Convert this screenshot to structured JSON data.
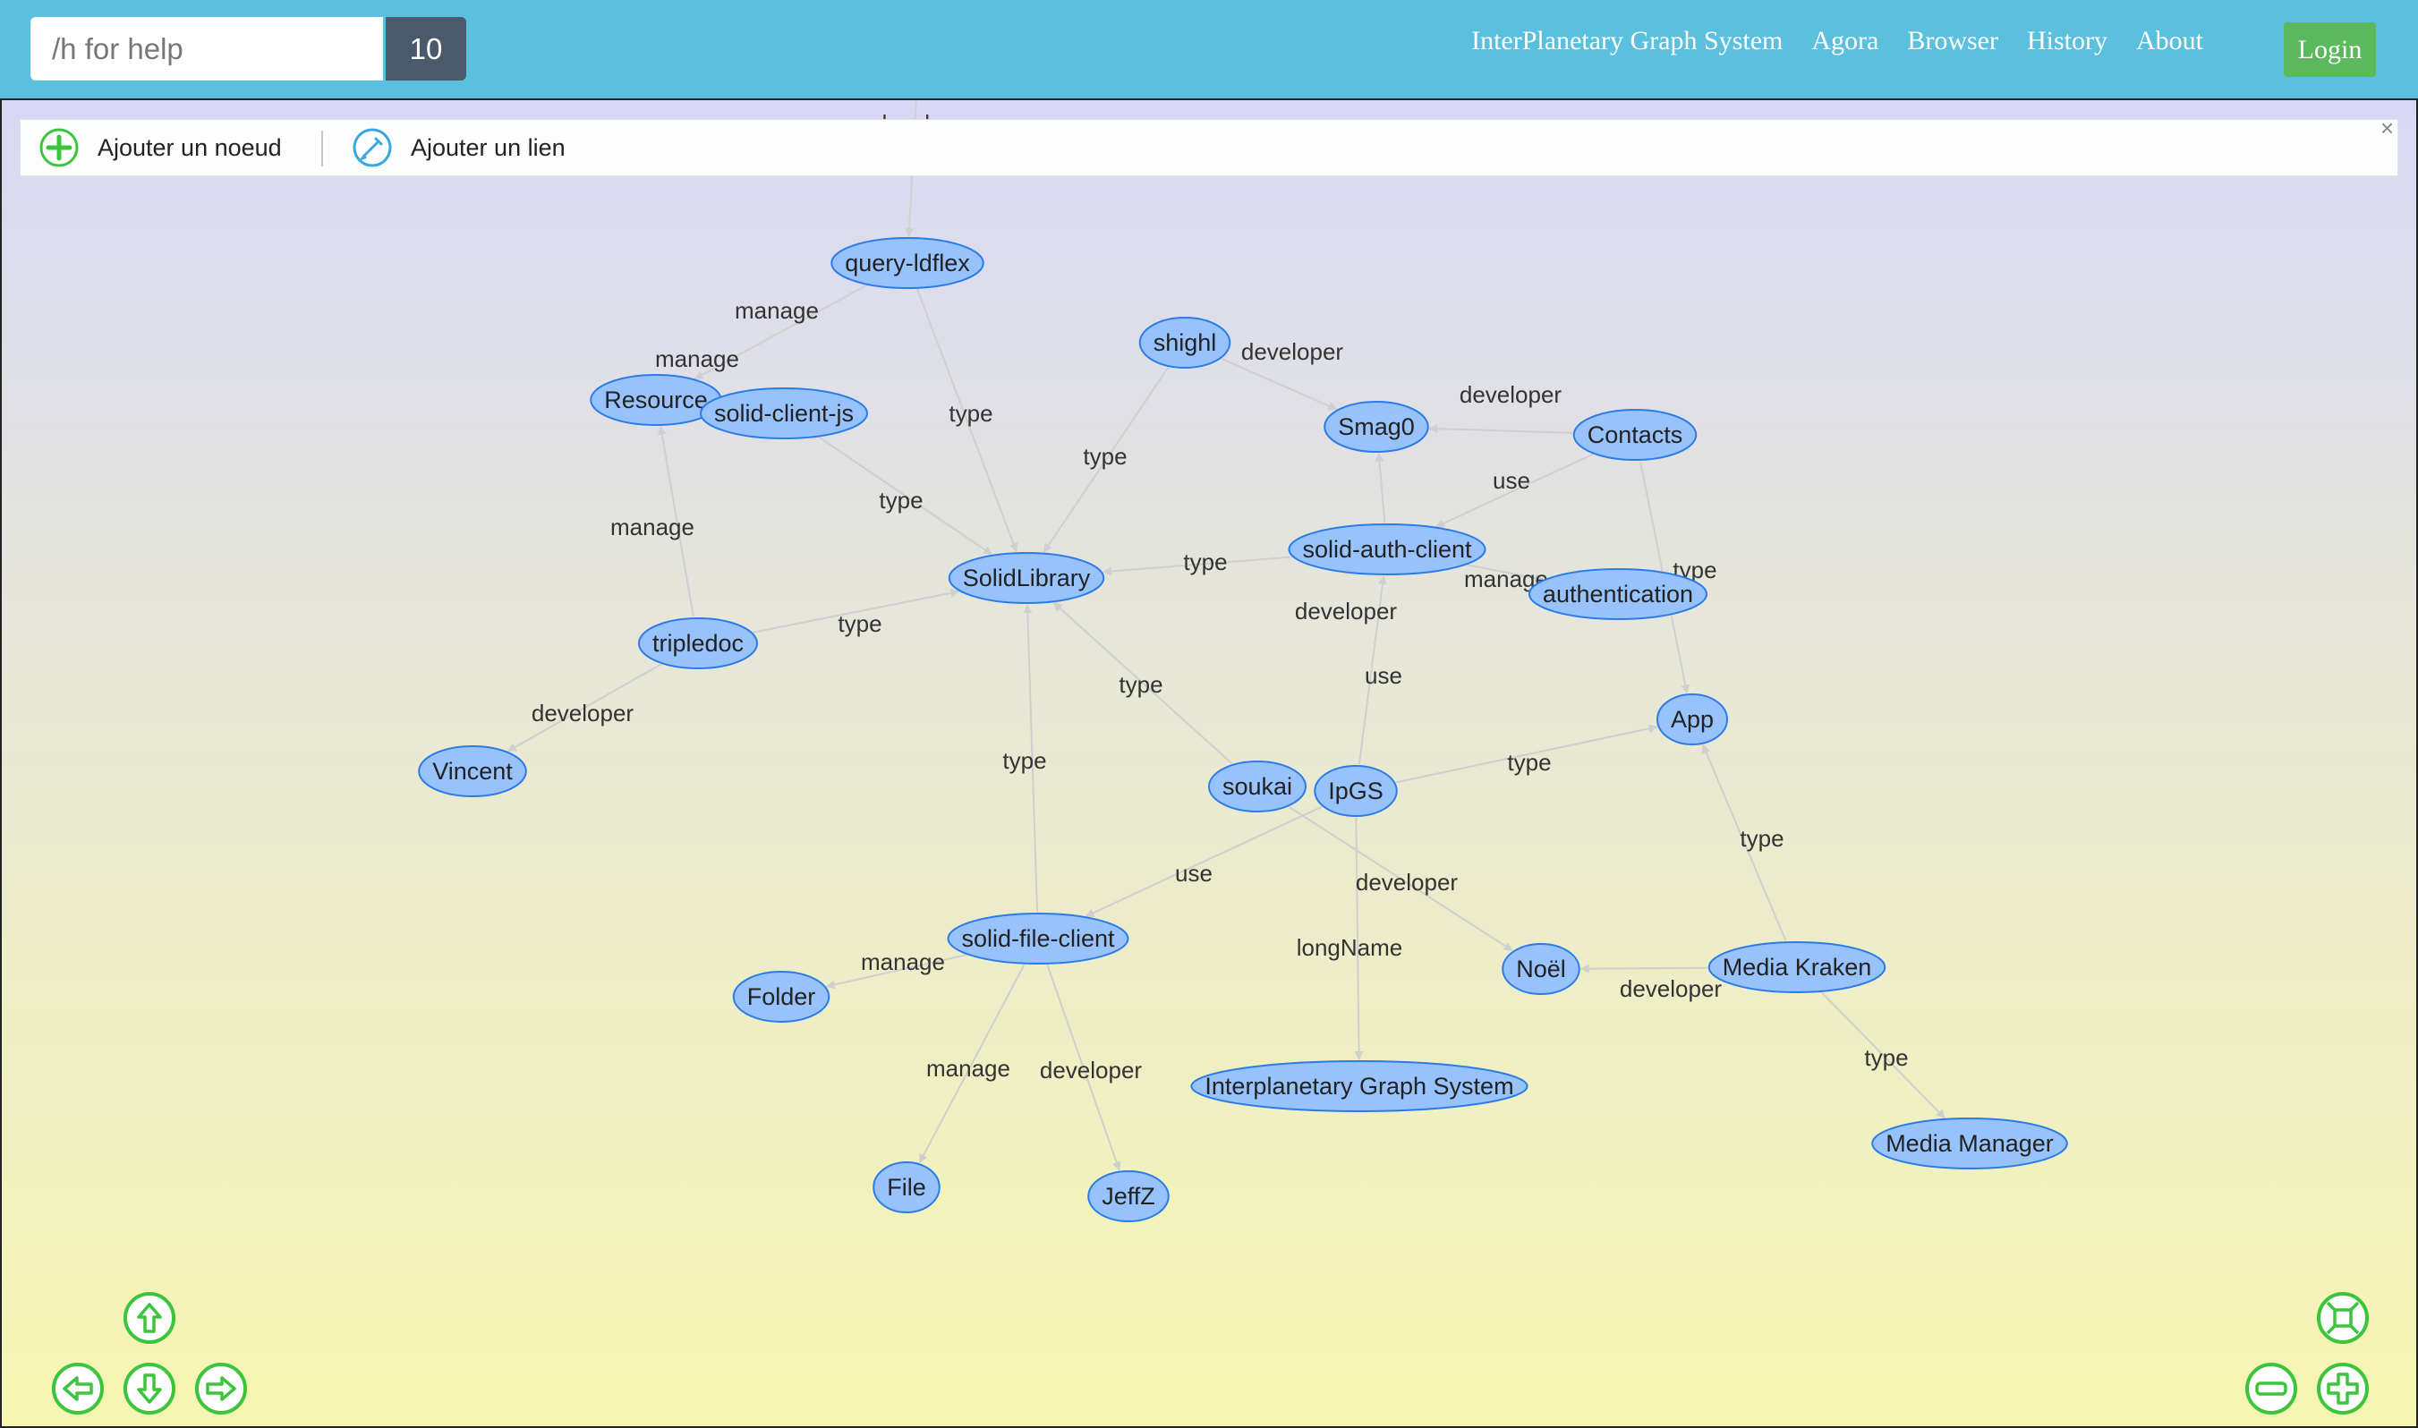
{
  "header": {
    "search_placeholder": "/h for help",
    "count": "10",
    "nav": [
      "InterPlanetary Graph System",
      "Agora",
      "Browser",
      "History",
      "About"
    ],
    "login": "Login"
  },
  "toolbar": {
    "add_node": "Ajouter un noeud",
    "add_link": "Ajouter un lien",
    "close": "×"
  },
  "icons": {
    "add_node": "plus-circle-icon",
    "add_link": "pencil-circle-icon",
    "pan_up": "arrow-up-icon",
    "pan_left": "arrow-left-icon",
    "pan_down": "arrow-down-icon",
    "pan_right": "arrow-right-icon",
    "fit": "fit-screen-icon",
    "zoom_out": "zoom-out-icon",
    "zoom_in": "zoom-in-icon"
  },
  "colors": {
    "navbar": "#5bc0de",
    "login": "#5cb85c",
    "node_fill": "#97c2fc",
    "node_stroke": "#2b7ce9",
    "edge": "#cfcfcf",
    "control": "#3cc43c"
  },
  "graph": {
    "nodes": [
      {
        "id": "query-ldflex",
        "label": "query-ldflex"
      },
      {
        "id": "shighl",
        "label": "shighl"
      },
      {
        "id": "Resource",
        "label": "Resource"
      },
      {
        "id": "solid-client-js",
        "label": "solid-client-js"
      },
      {
        "id": "Smag0",
        "label": "Smag0"
      },
      {
        "id": "Contacts",
        "label": "Contacts"
      },
      {
        "id": "solid-auth-client",
        "label": "solid-auth-client"
      },
      {
        "id": "SolidLibrary",
        "label": "SolidLibrary"
      },
      {
        "id": "authentication",
        "label": "authentication"
      },
      {
        "id": "tripledoc",
        "label": "tripledoc"
      },
      {
        "id": "App",
        "label": "App"
      },
      {
        "id": "Vincent",
        "label": "Vincent"
      },
      {
        "id": "soukai",
        "label": "soukai"
      },
      {
        "id": "IpGS",
        "label": "IpGS"
      },
      {
        "id": "solid-file-client",
        "label": "solid-file-client"
      },
      {
        "id": "Noel",
        "label": "Noël"
      },
      {
        "id": "Media Kraken",
        "label": "Media Kraken"
      },
      {
        "id": "Folder",
        "label": "Folder"
      },
      {
        "id": "Interplanetary Graph System",
        "label": "Interplanetary Graph System"
      },
      {
        "id": "Media Manager",
        "label": "Media Manager"
      },
      {
        "id": "File",
        "label": "File"
      },
      {
        "id": "JeffZ",
        "label": "JeffZ"
      }
    ],
    "edges": [
      {
        "from": "top",
        "to": "query-ldflex",
        "label": "developer"
      },
      {
        "from": "query-ldflex",
        "to": "Resource",
        "label": "manage"
      },
      {
        "from": "solid-client-js",
        "to": "Resource",
        "label": "manage"
      },
      {
        "from": "query-ldflex",
        "to": "SolidLibrary",
        "label": "type"
      },
      {
        "from": "shighl",
        "to": "SolidLibrary",
        "label": "type"
      },
      {
        "from": "shighl",
        "to": "Smag0",
        "label": "developer"
      },
      {
        "from": "Contacts",
        "to": "Smag0",
        "label": "developer"
      },
      {
        "from": "Contacts",
        "to": "solid-auth-client",
        "label": "use"
      },
      {
        "from": "Contacts",
        "to": "App",
        "label": "type"
      },
      {
        "from": "solid-client-js",
        "to": "SolidLibrary",
        "label": "type"
      },
      {
        "from": "solid-auth-client",
        "to": "SolidLibrary",
        "label": "type"
      },
      {
        "from": "solid-auth-client",
        "to": "authentication",
        "label": "manage"
      },
      {
        "from": "solid-auth-client",
        "to": "Smag0",
        "label": "developer"
      },
      {
        "from": "tripledoc",
        "to": "Resource",
        "label": "manage"
      },
      {
        "from": "tripledoc",
        "to": "SolidLibrary",
        "label": "type"
      },
      {
        "from": "tripledoc",
        "to": "Vincent",
        "label": "developer"
      },
      {
        "from": "soukai",
        "to": "SolidLibrary",
        "label": "type"
      },
      {
        "from": "IpGS",
        "to": "solid-auth-client",
        "label": "use"
      },
      {
        "from": "IpGS",
        "to": "App",
        "label": "type"
      },
      {
        "from": "IpGS",
        "to": "solid-file-client",
        "label": "use"
      },
      {
        "from": "soukai",
        "to": "Noel",
        "label": "developer"
      },
      {
        "from": "IpGS",
        "to": "Interplanetary Graph System",
        "label": "longName"
      },
      {
        "from": "solid-file-client",
        "to": "SolidLibrary",
        "label": "type"
      },
      {
        "from": "solid-file-client",
        "to": "Folder",
        "label": "manage"
      },
      {
        "from": "solid-file-client",
        "to": "File",
        "label": "manage"
      },
      {
        "from": "solid-file-client",
        "to": "JeffZ",
        "label": "developer"
      },
      {
        "from": "Media Kraken",
        "to": "Noel",
        "label": "developer"
      },
      {
        "from": "Media Kraken",
        "to": "App",
        "label": "type"
      },
      {
        "from": "Media Kraken",
        "to": "Media Manager",
        "label": "type"
      }
    ]
  }
}
